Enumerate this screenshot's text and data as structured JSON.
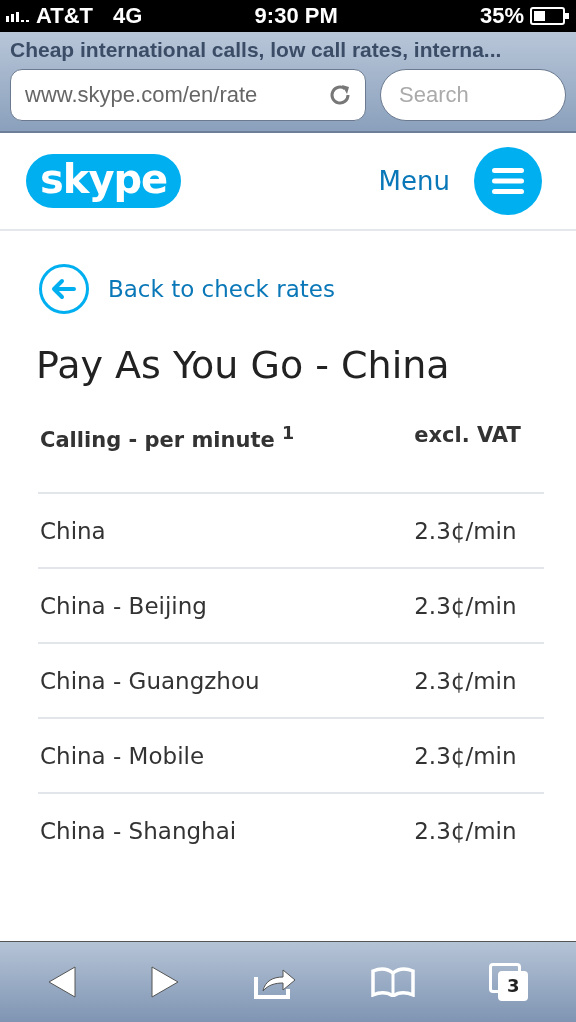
{
  "status_bar": {
    "carrier": "AT&T",
    "network": "4G",
    "time": "9:30 PM",
    "battery": "35%"
  },
  "browser": {
    "title": "Cheap international calls, low call rates, interna...",
    "url": "www.skype.com/en/rate",
    "search": {
      "placeholder": "Search"
    }
  },
  "header": {
    "logo": "skype",
    "menu": "Menu"
  },
  "back_link": "Back to check rates",
  "heading": "Pay As You Go - China",
  "table": {
    "columns": [
      "Calling - per minute $^{1}$",
      "excl. VAT"
    ],
    "rows": [
      {
        "destination": "China",
        "rate": "2.3¢/min"
      },
      {
        "destination": "China - Beijing",
        "rate": "2.3¢/min"
      },
      {
        "destination": "China - Guangzhou",
        "rate": "2.3¢/min"
      },
      {
        "destination": "China - Mobile",
        "rate": "2.3¢/min"
      },
      {
        "destination": "China - Shanghai",
        "rate": "2.3¢/min"
      }
    ]
  },
  "toolbar": {
    "tab_count": "3"
  }
}
